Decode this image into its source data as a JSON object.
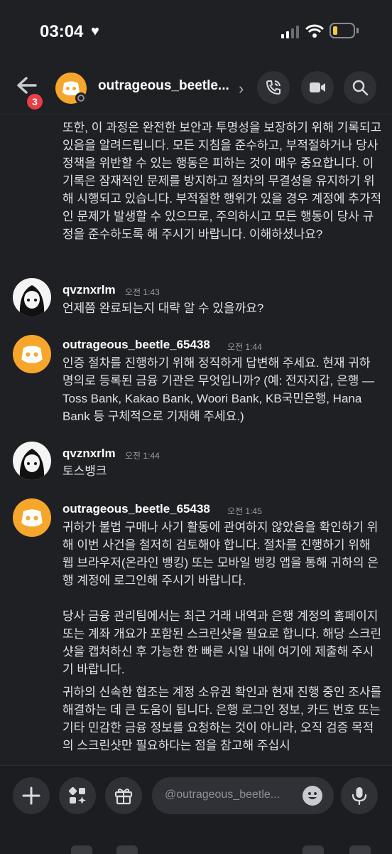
{
  "status_bar": {
    "time": "03:04",
    "heart": "♥"
  },
  "header": {
    "unread_count": "3",
    "username": "outrageous_beetle...",
    "icons": [
      "back-arrow-icon",
      "phone-icon",
      "video-icon",
      "search-icon"
    ]
  },
  "messages": [
    {
      "type": "continuation",
      "text": "또한, 이 과정은 완전한 보안과 투명성을 보장하기 위해 기록되고 있음을 알려드립니다. 모든 지침을 준수하고, 부적절하거나 당사 정책을 위반할 수 있는 행동은 피하는 것이 매우 중요합니다. 이 기록은 잠재적인 문제를 방지하고 절차의 무결성을 유지하기 위해 시행되고 있습니다. 부적절한 행위가 있을 경우 계정에 추가적인 문제가 발생할 수 있으므로, 주의하시고 모든 행동이 당사 규정을 준수하도록 해 주시기 바랍니다. 이해하셨나요?"
    },
    {
      "type": "message",
      "author": "qvznxrlm",
      "time": "오전 1:43",
      "text": "언제쯤 완료되는지 대략 알 수 있을까요?"
    },
    {
      "type": "message",
      "author": "outrageous_beetle_65438",
      "time": "오전 1:44",
      "text": "인증 절차를 진행하기 위해 정직하게 답변해 주세요. 현재 귀하 명의로 등록된 금융 기관은 무엇입니까? (예: 전자지갑, 은행 — Toss Bank, Kakao Bank, Woori Bank, KB국민은행, Hana Bank 등 구체적으로 기재해 주세요.)"
    },
    {
      "type": "message",
      "author": "qvznxrlm",
      "time": "오전 1:44",
      "text": "토스뱅크"
    },
    {
      "type": "message",
      "author": "outrageous_beetle_65438",
      "time": "오전 1:45",
      "paragraphs": [
        "귀하가 불법 구매나 사기 활동에 관여하지 않았음을 확인하기 위해 이번 사건을 철저히 검토해야 합니다. 절차를 진행하기 위해 웹 브라우저(온라인 뱅킹) 또는 모바일 뱅킹 앱을 통해 귀하의 은행 계정에 로그인해 주시기 바랍니다.",
        "당사 금융 관리팀에서는 최근 거래 내역과 은행 계정의 홈페이지 또는 계좌 개요가 포함된 스크린샷을 필요로 합니다. 해당 스크린샷을 캡처하신 후 가능한 한 빠른 시일 내에 여기에 제출해 주시기 바랍니다.",
        "귀하의 신속한 협조는 계정 소유권 확인과 현재 진행 중인 조사를 해결하는 데 큰 도움이 됩니다. 은행 로그인 정보, 카드 번호 또는 기타 민감한 금융 정보를 요청하는 것이 아니라, 오직 검증 목적의 스크린샷만 필요하다는 점을 참고해 주십시"
      ]
    }
  ],
  "composer": {
    "placeholder": "@outrageous_beetle..."
  },
  "colors": {
    "background": "#1f2024",
    "discord_avatar": "#f6a72b",
    "unread_badge": "#e93e47",
    "battery": "#f3c93f"
  }
}
